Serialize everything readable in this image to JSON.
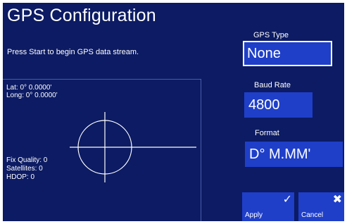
{
  "window": {
    "title": "GPS Configuration",
    "instructions": "Press Start to begin GPS data stream."
  },
  "position": {
    "lat": "Lat: 0° 0.0000'",
    "long": "Long: 0° 0.0000'"
  },
  "status": {
    "fix_quality": "Fix Quality: 0",
    "satellites": "Satellites: 0",
    "hdop": "HDOP: 0"
  },
  "settings": {
    "gps_type_label": "GPS Type",
    "gps_type_value": "None",
    "baud_rate_label": "Baud Rate",
    "baud_rate_value": "4800",
    "format_label": "Format",
    "format_value": "D° M.MM'"
  },
  "actions": {
    "apply_label": "Apply",
    "apply_icon": "check-icon",
    "cancel_label": "Cancel",
    "cancel_icon": "close-icon"
  },
  "colors": {
    "background": "#0c1b63",
    "button": "#1f3fc9",
    "text": "#ffffff"
  }
}
